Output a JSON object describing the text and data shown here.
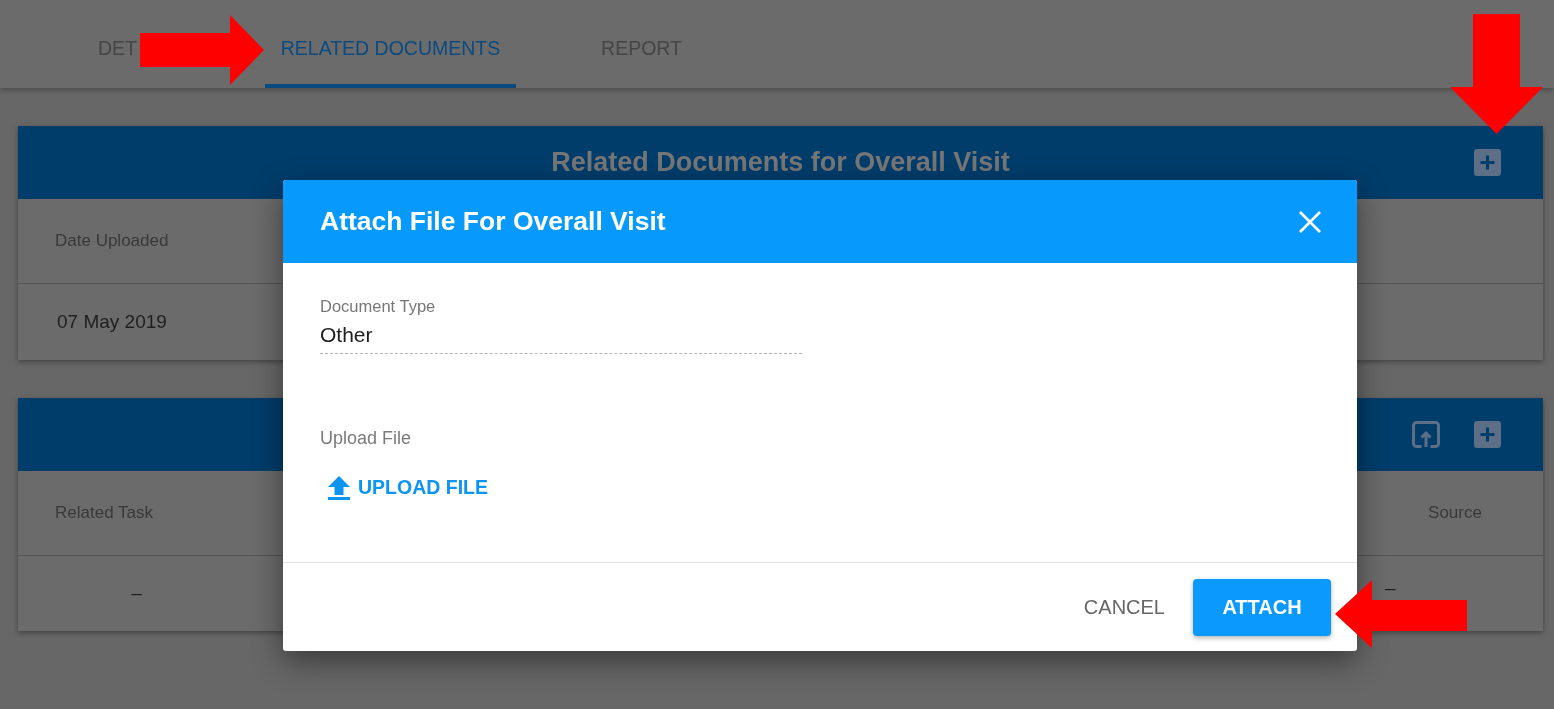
{
  "tabs": [
    {
      "label": "DET",
      "selected": false
    },
    {
      "label": "RELATED DOCUMENTS",
      "selected": true
    },
    {
      "label": "REPORT",
      "selected": false
    }
  ],
  "documents_panel": {
    "title": "Related Documents for Overall Visit",
    "actions": [
      {
        "kind": "add"
      }
    ],
    "columns": [
      "Date Uploaded"
    ],
    "rows": [
      [
        "07 May 2019"
      ]
    ]
  },
  "tasks_panel": {
    "actions": [
      {
        "kind": "upload"
      },
      {
        "kind": "add"
      }
    ],
    "columns": [
      "Related Task",
      "Source"
    ],
    "rows": [
      [
        "–",
        "–"
      ]
    ]
  },
  "dialog": {
    "title": "Attach File For Overall Visit",
    "document_type": {
      "label": "Document Type",
      "value": "Other"
    },
    "upload": {
      "label": "Upload File",
      "button": "UPLOAD FILE"
    },
    "buttons": [
      {
        "label": "CANCEL",
        "kind": "flat"
      },
      {
        "label": "ATTACH",
        "kind": "raised"
      }
    ]
  },
  "annotation_arrows": [
    {
      "kind": "right"
    },
    {
      "kind": "down"
    },
    {
      "kind": "left"
    }
  ]
}
